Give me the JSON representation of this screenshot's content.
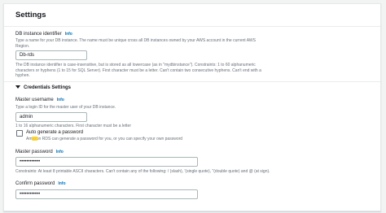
{
  "settings": {
    "title": "Settings"
  },
  "db_identifier": {
    "label": "DB instance identifier",
    "info": "Info",
    "description": "Type a name for your DB instance. The name must be unique cross all DB instances owned by your AWS account in the current AWS Region.",
    "value": "Db-rds",
    "constraints": "The DB instance identifier is case-insensitive, but is stored as all lowercase (as in \"mydbinstance\"). Constraints: 1 to 60 alphanumeric characters or hyphens (1 to 15 for SQL Server). First character must be a letter. Can't contain two consecutive hyphens. Can't end with a hyphen."
  },
  "credentials": {
    "section_title": "Credentials Settings",
    "master_username_label": "Master username",
    "master_username_info": "Info",
    "master_username_description": "Type a login ID for the master user of your DB instance.",
    "master_username_value": "admin",
    "master_username_constraints": "1 to 16 alphanumeric characters. First character must be a letter",
    "auto_generate_label": "Auto generate a password",
    "auto_generate_checked": false,
    "auto_generate_description": "Amazon RDS can generate a password for you, or you can specify your own password",
    "master_password_label": "Master password",
    "master_password_info": "Info",
    "master_password_value": "••••••••••••",
    "master_password_constraints": "Constraints: At least 8 printable ASCII characters. Can't contain any of the following: / (slash), '(single quote), \"(double quote) and @ (at sign).",
    "confirm_password_label": "Confirm password",
    "confirm_password_info": "Info",
    "confirm_password_value": "••••••••••••"
  },
  "colors": {
    "link": "#0073bb",
    "border": "#aab7b8",
    "text_secondary": "#687078",
    "background": "#f2f3f3",
    "cursor_highlight": "#ffd21e"
  },
  "icons": {
    "section_toggle": "caret-down-icon"
  }
}
